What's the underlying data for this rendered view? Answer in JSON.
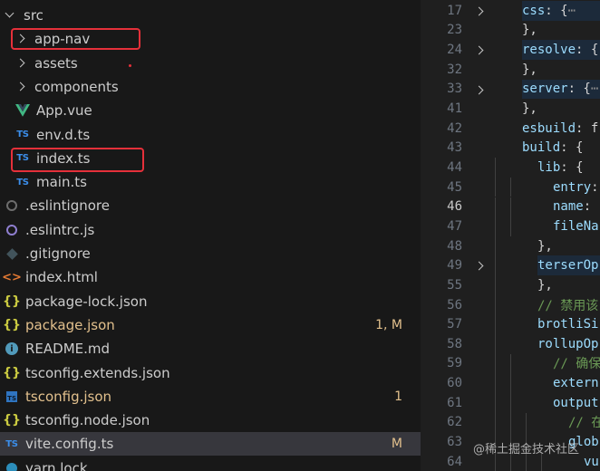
{
  "explorer": {
    "rows": [
      {
        "label": "src",
        "chevron": "down",
        "indent": 0,
        "icon": "none",
        "icon_text": ""
      },
      {
        "label": "app-nav",
        "chevron": "right",
        "indent": 1,
        "icon": "none",
        "icon_text": ""
      },
      {
        "label": "assets",
        "chevron": "right",
        "indent": 1,
        "icon": "none",
        "icon_text": ""
      },
      {
        "label": "components",
        "chevron": "right",
        "indent": 1,
        "icon": "none",
        "icon_text": ""
      },
      {
        "label": "App.vue",
        "chevron": "",
        "indent": 1,
        "icon": "vue",
        "icon_text": ""
      },
      {
        "label": "env.d.ts",
        "chevron": "",
        "indent": 1,
        "icon": "ts",
        "icon_text": "TS"
      },
      {
        "label": "index.ts",
        "chevron": "",
        "indent": 1,
        "icon": "ts",
        "icon_text": "TS"
      },
      {
        "label": "main.ts",
        "chevron": "",
        "indent": 1,
        "icon": "ts",
        "icon_text": "TS"
      },
      {
        "label": ".eslintignore",
        "chevron": "",
        "indent": 0,
        "icon": "eslintignore",
        "icon_text": ""
      },
      {
        "label": ".eslintrc.js",
        "chevron": "",
        "indent": 0,
        "icon": "eslint",
        "icon_text": ""
      },
      {
        "label": ".gitignore",
        "chevron": "",
        "indent": 0,
        "icon": "git",
        "icon_text": ""
      },
      {
        "label": "index.html",
        "chevron": "",
        "indent": 0,
        "icon": "html",
        "icon_text": "<>"
      },
      {
        "label": "package-lock.json",
        "chevron": "",
        "indent": 0,
        "icon": "json",
        "icon_text": "{}"
      },
      {
        "label": "package.json",
        "chevron": "",
        "indent": 0,
        "icon": "json",
        "icon_text": "{}",
        "modified": true,
        "badge": "1, M"
      },
      {
        "label": "README.md",
        "chevron": "",
        "indent": 0,
        "icon": "info",
        "icon_text": "i"
      },
      {
        "label": "tsconfig.extends.json",
        "chevron": "",
        "indent": 0,
        "icon": "json",
        "icon_text": "{}"
      },
      {
        "label": "tsconfig.json",
        "chevron": "",
        "indent": 0,
        "icon": "tsconfig",
        "icon_text": "TS",
        "modified": true,
        "badge": "1"
      },
      {
        "label": "tsconfig.node.json",
        "chevron": "",
        "indent": 0,
        "icon": "json",
        "icon_text": "{}"
      },
      {
        "label": "vite.config.ts",
        "chevron": "",
        "indent": 0,
        "icon": "ts",
        "icon_text": "TS",
        "modified": true,
        "badge": "M",
        "selected": true
      },
      {
        "label": "yarn.lock",
        "chevron": "",
        "indent": 0,
        "icon": "yarn",
        "icon_text": ""
      }
    ],
    "highlighted": [
      "app-nav",
      "index.ts"
    ],
    "colors": {
      "highlight_border": "#e5303a",
      "modified_text": "#e2c08d",
      "selected_bg": "#37373d"
    }
  },
  "editor": {
    "active_line": "46",
    "lines": [
      {
        "num": "17",
        "fold": true,
        "depth": 1,
        "folded": true,
        "tokens": [
          {
            "t": "css",
            "c": "k"
          },
          {
            "t": ": {",
            "c": "p"
          },
          {
            "t": "⋯",
            "c": "fe"
          }
        ]
      },
      {
        "num": "23",
        "fold": false,
        "depth": 1,
        "tokens": [
          {
            "t": "},",
            "c": "p"
          }
        ]
      },
      {
        "num": "24",
        "fold": true,
        "depth": 1,
        "folded": true,
        "tokens": [
          {
            "t": "resolve",
            "c": "k"
          },
          {
            "t": ": {",
            "c": "p"
          }
        ]
      },
      {
        "num": "32",
        "fold": false,
        "depth": 1,
        "tokens": [
          {
            "t": "},",
            "c": "p"
          }
        ]
      },
      {
        "num": "33",
        "fold": true,
        "depth": 1,
        "folded": true,
        "tokens": [
          {
            "t": "server",
            "c": "k"
          },
          {
            "t": ": {",
            "c": "p"
          },
          {
            "t": "⋯",
            "c": "fe"
          }
        ]
      },
      {
        "num": "41",
        "fold": false,
        "depth": 1,
        "tokens": [
          {
            "t": "},",
            "c": "p"
          }
        ]
      },
      {
        "num": "42",
        "fold": false,
        "depth": 1,
        "tokens": [
          {
            "t": "esbuild",
            "c": "k"
          },
          {
            "t": ": f",
            "c": "p"
          }
        ]
      },
      {
        "num": "43",
        "fold": false,
        "depth": 1,
        "tokens": [
          {
            "t": "build",
            "c": "k"
          },
          {
            "t": ": {",
            "c": "p"
          }
        ]
      },
      {
        "num": "44",
        "fold": false,
        "depth": 2,
        "tokens": [
          {
            "t": "lib",
            "c": "k"
          },
          {
            "t": ": {",
            "c": "p"
          }
        ]
      },
      {
        "num": "45",
        "fold": false,
        "depth": 3,
        "tokens": [
          {
            "t": "entry",
            "c": "k"
          },
          {
            "t": ":",
            "c": "p"
          }
        ]
      },
      {
        "num": "46",
        "fold": false,
        "depth": 3,
        "tokens": [
          {
            "t": "name",
            "c": "k"
          },
          {
            "t": ":",
            "c": "p"
          }
        ]
      },
      {
        "num": "47",
        "fold": false,
        "depth": 3,
        "tokens": [
          {
            "t": "fileNa",
            "c": "k"
          }
        ]
      },
      {
        "num": "48",
        "fold": false,
        "depth": 2,
        "tokens": [
          {
            "t": "},",
            "c": "p"
          }
        ]
      },
      {
        "num": "49",
        "fold": true,
        "depth": 2,
        "folded": true,
        "tokens": [
          {
            "t": "terserOp",
            "c": "k"
          }
        ]
      },
      {
        "num": "55",
        "fold": false,
        "depth": 2,
        "tokens": [
          {
            "t": "},",
            "c": "p"
          }
        ]
      },
      {
        "num": "56",
        "fold": false,
        "depth": 2,
        "tokens": [
          {
            "t": "// 禁用该",
            "c": "c"
          }
        ]
      },
      {
        "num": "57",
        "fold": false,
        "depth": 2,
        "tokens": [
          {
            "t": "brotliSi",
            "c": "k"
          }
        ]
      },
      {
        "num": "58",
        "fold": false,
        "depth": 2,
        "tokens": [
          {
            "t": "rollupOp",
            "c": "k"
          }
        ]
      },
      {
        "num": "59",
        "fold": false,
        "depth": 3,
        "tokens": [
          {
            "t": "// 确保",
            "c": "c"
          }
        ]
      },
      {
        "num": "60",
        "fold": false,
        "depth": 3,
        "tokens": [
          {
            "t": "extern",
            "c": "k"
          }
        ]
      },
      {
        "num": "61",
        "fold": false,
        "depth": 3,
        "tokens": [
          {
            "t": "output",
            "c": "k"
          }
        ]
      },
      {
        "num": "62",
        "fold": false,
        "depth": 4,
        "tokens": [
          {
            "t": "// 在",
            "c": "c"
          }
        ]
      },
      {
        "num": "63",
        "fold": false,
        "depth": 4,
        "tokens": [
          {
            "t": "glob",
            "c": "k"
          }
        ]
      },
      {
        "num": "64",
        "fold": false,
        "depth": 5,
        "tokens": [
          {
            "t": "vu",
            "c": "k"
          }
        ]
      }
    ]
  },
  "watermark": "@稀土掘金技术社区"
}
